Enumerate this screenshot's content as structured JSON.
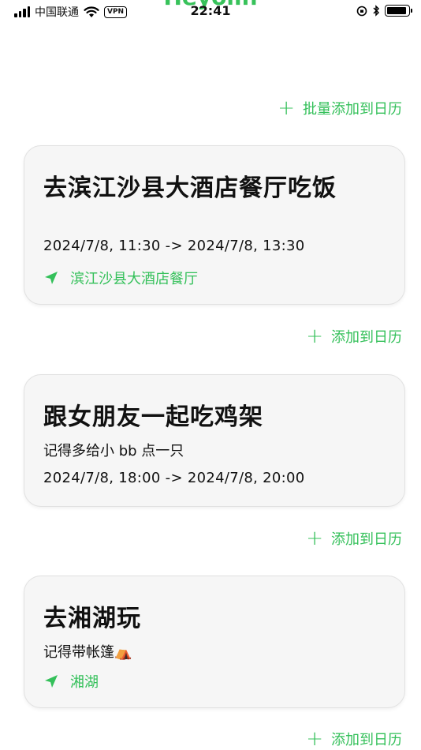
{
  "status_bar": {
    "carrier": "中国联通",
    "vpn": "VPN",
    "time": "22:41",
    "peek_title": "Heyolin"
  },
  "colors": {
    "accent": "#34c05a",
    "card_bg": "#f6f6f6"
  },
  "batch_add_label": "批量添加到日历",
  "events": [
    {
      "title": "去滨江沙县大酒店餐厅吃饭",
      "time": "2024/7/8, 11:30  ->  2024/7/8, 13:30",
      "location": "滨江沙县大酒店餐厅",
      "add_label": "添加到日历"
    },
    {
      "title": "跟女朋友一起吃鸡架",
      "note": "记得多给小 bb 点一只",
      "time": "2024/7/8, 18:00  ->  2024/7/8, 20:00",
      "add_label": "添加到日历"
    },
    {
      "title": "去湘湖玩",
      "note": "记得带帐篷⛺",
      "location": "湘湖",
      "add_label": "添加到日历"
    }
  ]
}
